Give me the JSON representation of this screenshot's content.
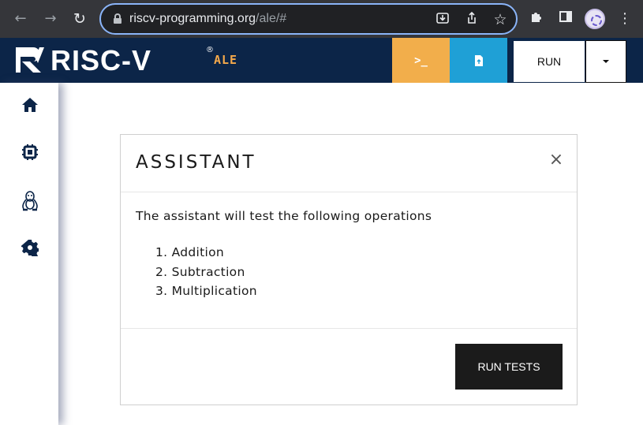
{
  "browser": {
    "url_host": "riscv-programming.org",
    "url_path": "/ale/#",
    "icons": {
      "back": "arrow-left-icon",
      "forward": "arrow-right-icon",
      "reload": "reload-icon",
      "lock": "lock-icon",
      "install": "install-app-icon",
      "share": "share-icon",
      "bookmark": "star-icon",
      "extensions": "puzzle-icon",
      "sidepanel": "side-panel-icon",
      "profile": "profile-avatar",
      "menu": "kebab-menu-icon"
    }
  },
  "header": {
    "logo_text": "RISC-V",
    "logo_reg": "®",
    "logo_sub": "ALE",
    "terminal_label": ">_",
    "run_label": "RUN",
    "colors": {
      "bar": "#0c2548",
      "terminal": "#f2ae4b",
      "file": "#1fa0d6",
      "accent": "#f5a94b"
    }
  },
  "sidebar": {
    "items": [
      {
        "name": "home",
        "icon": "home-icon"
      },
      {
        "name": "chip",
        "icon": "cpu-chip-icon"
      },
      {
        "name": "linux",
        "icon": "tux-linux-icon"
      },
      {
        "name": "settings",
        "icon": "gear-icon"
      }
    ]
  },
  "modal": {
    "title": "ASSISTANT",
    "close_glyph": "×",
    "intro": "The assistant will test the following operations",
    "operations": [
      "1. Addition",
      "2. Subtraction",
      "3. Multiplication"
    ],
    "button_label": "RUN TESTS"
  }
}
